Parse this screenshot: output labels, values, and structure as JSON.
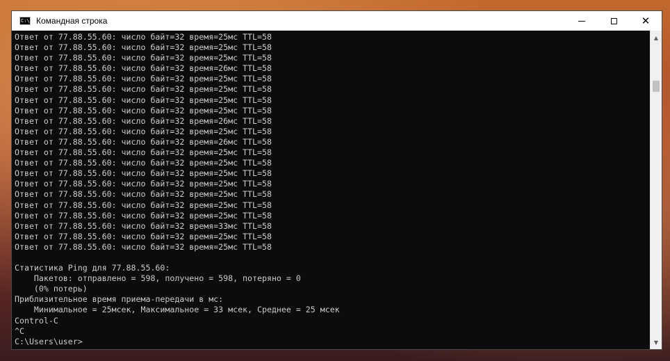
{
  "window": {
    "title": "Командная строка",
    "icon_text": "C:\\."
  },
  "console": {
    "lines": [
      "Ответ от 77.88.55.60: число байт=32 время=25мс TTL=58",
      "Ответ от 77.88.55.60: число байт=32 время=25мс TTL=58",
      "Ответ от 77.88.55.60: число байт=32 время=25мс TTL=58",
      "Ответ от 77.88.55.60: число байт=32 время=26мс TTL=58",
      "Ответ от 77.88.55.60: число байт=32 время=25мс TTL=58",
      "Ответ от 77.88.55.60: число байт=32 время=25мс TTL=58",
      "Ответ от 77.88.55.60: число байт=32 время=25мс TTL=58",
      "Ответ от 77.88.55.60: число байт=32 время=25мс TTL=58",
      "Ответ от 77.88.55.60: число байт=32 время=26мс TTL=58",
      "Ответ от 77.88.55.60: число байт=32 время=25мс TTL=58",
      "Ответ от 77.88.55.60: число байт=32 время=26мс TTL=58",
      "Ответ от 77.88.55.60: число байт=32 время=25мс TTL=58",
      "Ответ от 77.88.55.60: число байт=32 время=25мс TTL=58",
      "Ответ от 77.88.55.60: число байт=32 время=25мс TTL=58",
      "Ответ от 77.88.55.60: число байт=32 время=25мс TTL=58",
      "Ответ от 77.88.55.60: число байт=32 время=25мс TTL=58",
      "Ответ от 77.88.55.60: число байт=32 время=25мс TTL=58",
      "Ответ от 77.88.55.60: число байт=32 время=25мс TTL=58",
      "Ответ от 77.88.55.60: число байт=32 время=33мс TTL=58",
      "Ответ от 77.88.55.60: число байт=32 время=25мс TTL=58",
      "Ответ от 77.88.55.60: число байт=32 время=25мс TTL=58",
      "",
      "Статистика Ping для 77.88.55.60:",
      "    Пакетов: отправлено = 598, получено = 598, потеряно = 0",
      "    (0% потерь)",
      "Приблизительное время приема-передачи в мс:",
      "    Минимальное = 25мсек, Максимальное = 33 мсек, Среднее = 25 мсек",
      "Control-C",
      "^C",
      "C:\\Users\\user>"
    ]
  },
  "icons": {
    "minimize": "minimize-icon",
    "maximize": "maximize-icon",
    "close": "close-icon",
    "scroll_up": "chevron-up-icon",
    "scroll_down": "chevron-down-icon"
  },
  "colors": {
    "console_bg": "#0c0c0c",
    "console_fg": "#cccccc",
    "titlebar_bg": "#ffffff"
  }
}
